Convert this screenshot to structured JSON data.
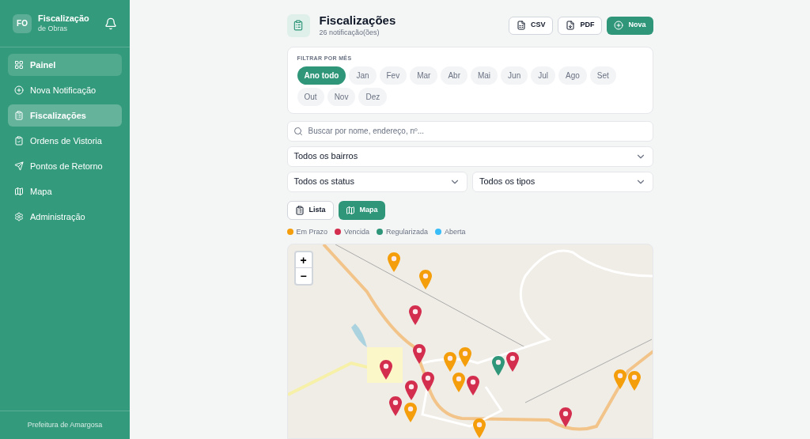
{
  "sidebar": {
    "logo": "FO",
    "title": "Fiscalização",
    "subtitle": "de Obras",
    "items": [
      {
        "label": "Painel",
        "selected": false,
        "highlighted": true
      },
      {
        "label": "Nova Notificação",
        "selected": false,
        "highlighted": false
      },
      {
        "label": "Fiscalizações",
        "selected": true,
        "highlighted": false
      },
      {
        "label": "Ordens de Vistoria",
        "selected": false,
        "highlighted": false
      },
      {
        "label": "Pontos de Retorno",
        "selected": false,
        "highlighted": false
      },
      {
        "label": "Mapa",
        "selected": false,
        "highlighted": false
      },
      {
        "label": "Administração",
        "selected": false,
        "highlighted": false
      }
    ],
    "footer": "Prefeitura de Amargosa"
  },
  "header": {
    "title": "Fiscalizações",
    "subtitle": "26 notificação(ões)",
    "buttons": [
      {
        "label": "CSV",
        "kind": "csv"
      },
      {
        "label": "PDF",
        "kind": "pdf"
      },
      {
        "label": "Nova",
        "kind": "primary"
      }
    ]
  },
  "month_filter": {
    "label": "FILTRAR POR MÊS",
    "months": [
      {
        "label": "Ano todo",
        "selected": true
      },
      {
        "label": "Jan",
        "selected": false
      },
      {
        "label": "Fev",
        "selected": false
      },
      {
        "label": "Mar",
        "selected": false
      },
      {
        "label": "Abr",
        "selected": false
      },
      {
        "label": "Mai",
        "selected": false
      },
      {
        "label": "Jun",
        "selected": false
      },
      {
        "label": "Jul",
        "selected": false
      },
      {
        "label": "Ago",
        "selected": false
      },
      {
        "label": "Set",
        "selected": false
      },
      {
        "label": "Out",
        "selected": false
      },
      {
        "label": "Nov",
        "selected": false
      },
      {
        "label": "Dez",
        "selected": false
      }
    ]
  },
  "search": {
    "placeholder": "Buscar por nome, endereço, nº..."
  },
  "selects": {
    "bairro": "Todos os bairros",
    "status": "Todos os status",
    "tipo": "Todos os tipos"
  },
  "view_toggle": [
    {
      "label": "Lista",
      "selected": false
    },
    {
      "label": "Mapa",
      "selected": true
    }
  ],
  "legend": [
    {
      "label": "Em Prazo",
      "kind": "prazo",
      "color": "#f59e0b"
    },
    {
      "label": "Vencida",
      "kind": "vencida",
      "color": "#d42e4f"
    },
    {
      "label": "Regularizada",
      "kind": "regularizada",
      "color": "#2f9679"
    },
    {
      "label": "Aberta",
      "kind": "aberta",
      "color": "#38bdf8"
    }
  ],
  "map": {
    "zoom_in": "+",
    "zoom_out": "−",
    "markers": [
      {
        "kind": "prazo"
      },
      {
        "kind": "prazo"
      },
      {
        "kind": "vencida"
      },
      {
        "kind": "vencida"
      },
      {
        "kind": "vencida"
      },
      {
        "kind": "prazo"
      },
      {
        "kind": "prazo"
      },
      {
        "kind": "prazo"
      },
      {
        "kind": "vencida"
      },
      {
        "kind": "vencida"
      },
      {
        "kind": "vencida"
      },
      {
        "kind": "regularizada"
      },
      {
        "kind": "vencida"
      },
      {
        "kind": "vencida"
      },
      {
        "kind": "prazo"
      },
      {
        "kind": "prazo"
      },
      {
        "kind": "vencida"
      },
      {
        "kind": "prazo"
      },
      {
        "kind": "prazo"
      }
    ]
  }
}
